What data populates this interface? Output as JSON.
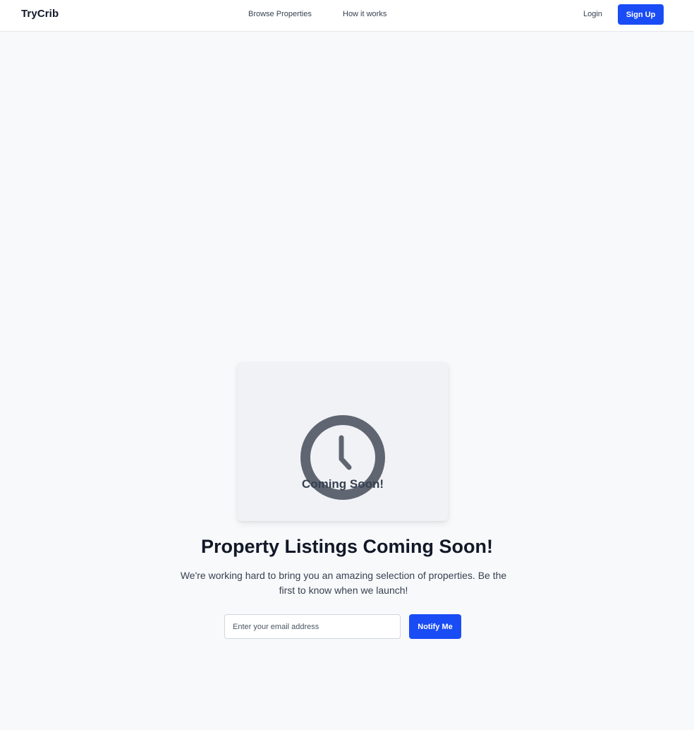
{
  "header": {
    "brand": "TryCrib",
    "nav": {
      "browse_label": "Browse Properties",
      "how_label": "How it works"
    },
    "login_label": "Login",
    "signup_label": "Sign Up"
  },
  "hero": {
    "card_icon": "clock-icon",
    "card_label": "Coming Soon!",
    "headline": "Property Listings Coming Soon!",
    "subtext": "We're working hard to bring you an amazing selection of properties. Be the first to know when we launch!"
  },
  "signup_form": {
    "email_placeholder": "Enter your email address",
    "email_value": "",
    "notify_label": "Notify Me"
  },
  "colors": {
    "accent": "#1a4cf5",
    "icon": "#5f6672",
    "background": "#f8f9fb"
  }
}
